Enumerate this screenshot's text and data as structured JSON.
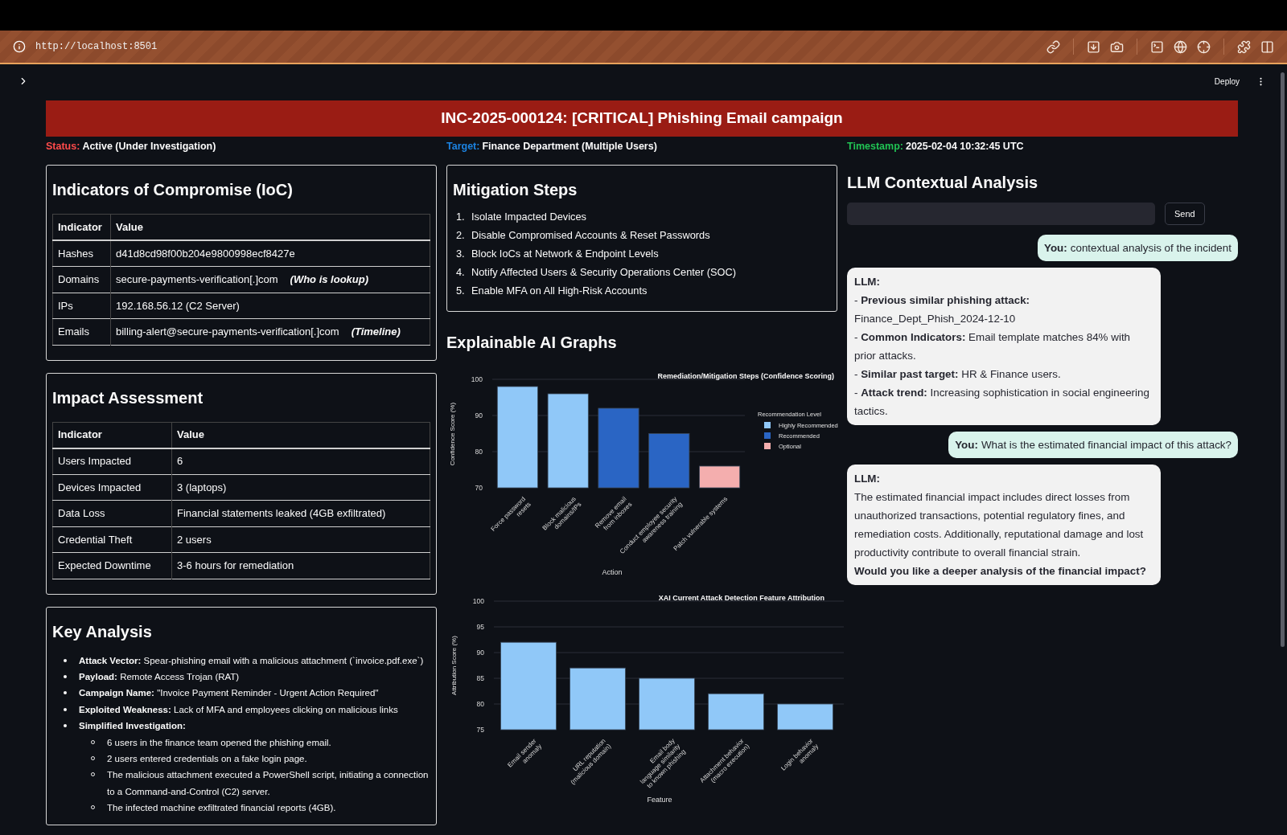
{
  "browser": {
    "url": "http://localhost:8501"
  },
  "app_header": {
    "deploy": "Deploy"
  },
  "banner": {
    "title": "INC-2025-000124: [CRITICAL] Phishing Email campaign"
  },
  "status_items": [
    {
      "label": "Status:",
      "value": "Active (Under Investigation)",
      "color": "#ff4b4b"
    },
    {
      "label": "Target:",
      "value": "Finance Department (Multiple Users)",
      "color": "#1c83e1"
    },
    {
      "label": "Timestamp:",
      "value": "2025-02-04 10:32:45 UTC",
      "color": "#21c354"
    }
  ],
  "ioc": {
    "title": "Indicators of Compromise (IoC)",
    "columns": [
      "Indicator",
      "Value"
    ],
    "rows": [
      {
        "indicator": "Hashes",
        "value": "d41d8cd98f00b204e9800998ecf8427e"
      },
      {
        "indicator": "Domains",
        "value": "secure-payments-verification[.]com",
        "note": "(Who is lookup)"
      },
      {
        "indicator": "IPs",
        "value": "192.168.56.12 (C2 Server)"
      },
      {
        "indicator": "Emails",
        "value": "billing-alert@secure-payments-verification[.]com",
        "note": "(Timeline)"
      }
    ]
  },
  "impact": {
    "title": "Impact Assessment",
    "columns": [
      "Indicator",
      "Value"
    ],
    "rows": [
      {
        "indicator": "Users Impacted",
        "value": "6"
      },
      {
        "indicator": "Devices Impacted",
        "value": "3 (laptops)"
      },
      {
        "indicator": "Data Loss",
        "value": "Financial statements leaked (4GB exfiltrated)"
      },
      {
        "indicator": "Credential Theft",
        "value": "2 users"
      },
      {
        "indicator": "Expected Downtime",
        "value": "3-6 hours for remediation"
      }
    ]
  },
  "key_analysis": {
    "title": "Key Analysis",
    "items": [
      {
        "text": "**Attack Vector:** Spear-phishing email with a malicious attachment (`invoice.pdf.exe`)"
      },
      {
        "text": "**Payload:** Remote Access Trojan (RAT)"
      },
      {
        "text": "**Campaign Name:** \"Invoice Payment Reminder - Urgent Action Required\""
      },
      {
        "text": "**Exploited Weakness:** Lack of MFA and employees clicking on malicious links"
      },
      {
        "text": "**Simplified Investigation:**",
        "children": [
          {
            "text": "6 users in the finance team opened the phishing email."
          },
          {
            "text": "2 users entered credentials on a fake login page."
          },
          {
            "text": "The malicious attachment executed a PowerShell script, initiating a connection to a Command-and-Control (C2) server."
          },
          {
            "text": "The infected machine exfiltrated financial reports (4GB)."
          }
        ]
      }
    ]
  },
  "mitigation": {
    "title": "Mitigation Steps",
    "steps": [
      {
        "number": "1.",
        "text": "Isolate Impacted Devices"
      },
      {
        "number": "2.",
        "text": "Disable Compromised Accounts & Reset Passwords"
      },
      {
        "number": "3.",
        "text": "Block IoCs at Network & Endpoint Levels"
      },
      {
        "number": "4.",
        "text": "Notify Affected Users & Security Operations Center (SOC)"
      },
      {
        "number": "5.",
        "text": "Enable MFA on All High-Risk Accounts"
      }
    ]
  },
  "xai": {
    "title": "Explainable AI Graphs",
    "charts": [
      {
        "chart_data": {
          "type": "bar",
          "title": "Remediation/Mitigation Steps (Confidence Scoring)",
          "xlabel": "Action",
          "ylabel": "Confidence Score (%)",
          "legend": {
            "title": "Recommendation Level"
          },
          "grid": true,
          "categories": [
            "Force password\nresets",
            "Block malicious\ndomains/IPs",
            "Remove email\nfrom inboxes",
            "Conduct employee security\nawareness training",
            "Patch vulnerable systems"
          ],
          "series": [
            {
              "name": "Highly Recommended",
              "color": "#90c8f8",
              "values": [
                98,
                96,
                null,
                null,
                null
              ]
            },
            {
              "name": "Recommended",
              "color": "#2a65c4",
              "values": [
                null,
                null,
                92,
                85,
                null
              ]
            },
            {
              "name": "Optional",
              "color": "#f4aeae",
              "values": [
                null,
                null,
                null,
                null,
                76
              ]
            }
          ],
          "ylim": [
            70,
            100
          ],
          "yticks": [
            70,
            80,
            90,
            100
          ],
          "stacked": true
        }
      },
      {
        "chart_data": {
          "type": "bar",
          "title": "XAI Current Attack Detection Feature Attribution",
          "xlabel": "Feature",
          "ylabel": "Attribution Score (%)",
          "categories": [
            "Email sender\nanomaly",
            "URL reputation\n(malicious domain)",
            "Email body\nlanguage similarity\nto known phishing",
            "Attachment behavior\n(macro execution)",
            "Login behavior\nanomaly"
          ],
          "values": [
            92,
            87,
            85,
            82,
            80
          ],
          "color": "#90c8f8",
          "grid": true,
          "ylim": [
            75,
            100
          ],
          "yticks": [
            75,
            80,
            85,
            90,
            95,
            100
          ]
        }
      }
    ]
  },
  "llm": {
    "title": "LLM Contextual Analysis",
    "send": "Send",
    "messages": [
      {
        "kind": "user",
        "label": "You:",
        "lines": [
          "contextual analysis of the incident"
        ]
      },
      {
        "kind": "llm",
        "label": "LLM:",
        "lines": [
          "- **Previous similar phishing attack:** Finance_Dept_Phish_2024-12-10",
          "- **Common Indicators:** Email template matches 84% with prior attacks.",
          "- **Similar past target:** HR & Finance users.",
          "- **Attack trend:** Increasing sophistication in social engineering tactics."
        ]
      },
      {
        "kind": "user",
        "label": "You:",
        "lines": [
          "What is the estimated financial impact of this attack?"
        ]
      },
      {
        "kind": "llm",
        "label": "LLM:",
        "lines": [
          "The estimated financial impact includes direct losses from unauthorized transactions, potential regulatory fines, and remediation costs. Additionally, reputational damage and lost productivity contribute to overall financial strain.",
          "**Would you like a deeper analysis of the financial impact?**"
        ]
      }
    ]
  }
}
